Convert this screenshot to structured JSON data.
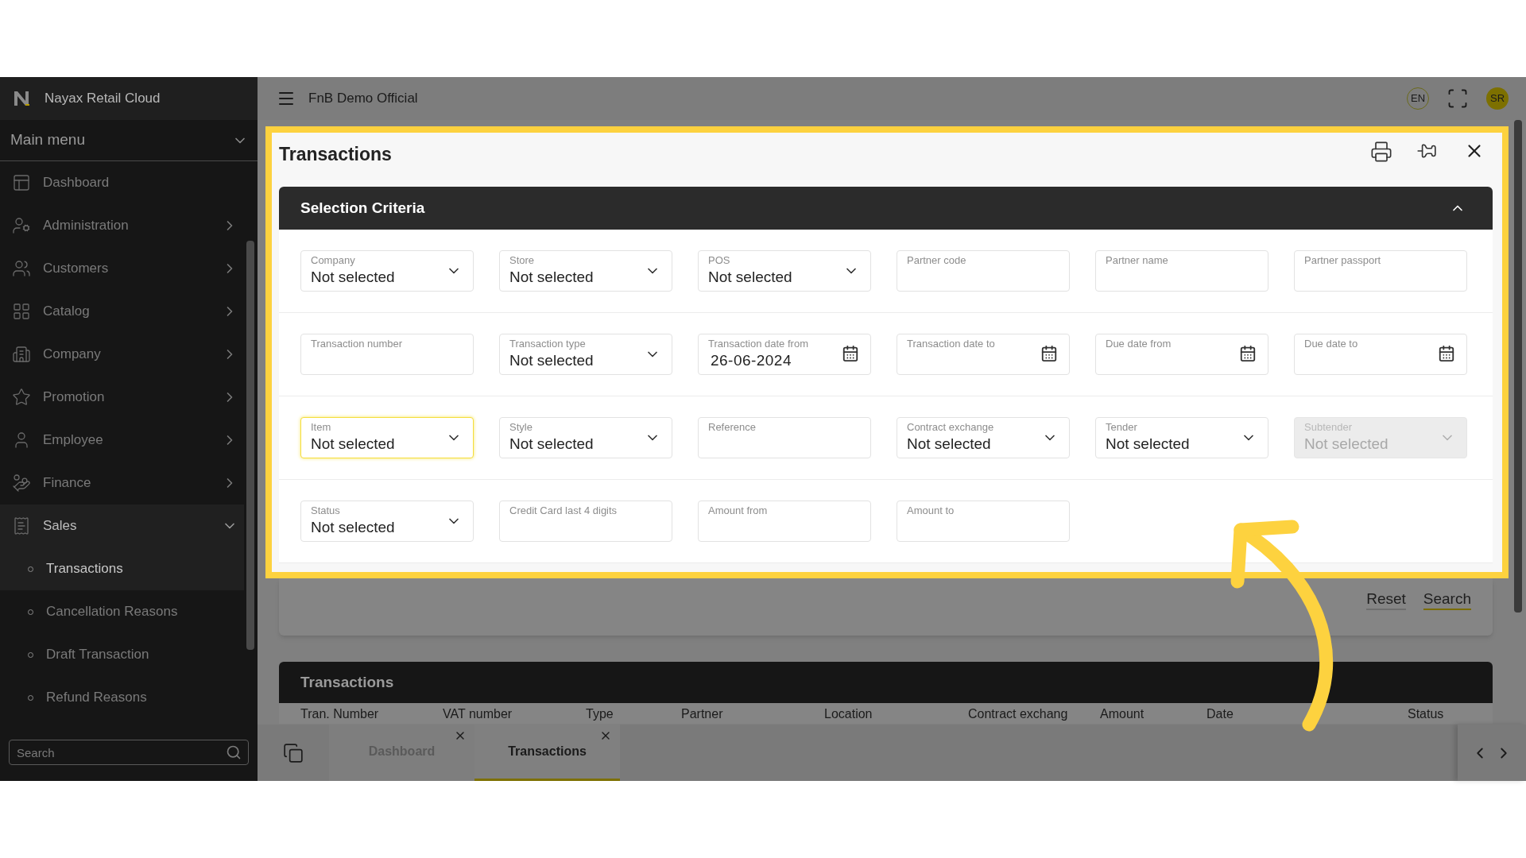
{
  "app": {
    "name": "Nayax Retail Cloud"
  },
  "sidebar": {
    "title": "Main menu",
    "items": [
      {
        "label": "Dashboard",
        "kind": "link",
        "expanded": false
      },
      {
        "label": "Administration",
        "kind": "group",
        "expanded": false
      },
      {
        "label": "Customers",
        "kind": "group",
        "expanded": false
      },
      {
        "label": "Catalog",
        "kind": "group",
        "expanded": false
      },
      {
        "label": "Company",
        "kind": "group",
        "expanded": false
      },
      {
        "label": "Promotion",
        "kind": "group",
        "expanded": false
      },
      {
        "label": "Employee",
        "kind": "group",
        "expanded": false
      },
      {
        "label": "Finance",
        "kind": "group",
        "expanded": false
      },
      {
        "label": "Sales",
        "kind": "group",
        "expanded": true,
        "children": [
          {
            "label": "Transactions",
            "selected": true
          },
          {
            "label": "Cancellation Reasons",
            "selected": false
          },
          {
            "label": "Draft Transaction",
            "selected": false
          },
          {
            "label": "Refund Reasons",
            "selected": false
          }
        ]
      }
    ],
    "search": {
      "placeholder": "Search"
    }
  },
  "header": {
    "title": "FnB Demo Official",
    "language": "EN",
    "user_initials": "SR"
  },
  "panel": {
    "title": "Transactions",
    "criteria": {
      "title": "Selection Criteria",
      "expanded": true,
      "rows": [
        [
          {
            "label": "Company",
            "kind": "select",
            "value": "Not selected",
            "focused": false,
            "disabled": false
          },
          {
            "label": "Store",
            "kind": "select",
            "value": "Not selected",
            "focused": false,
            "disabled": false
          },
          {
            "label": "POS",
            "kind": "select",
            "value": "Not selected",
            "focused": false,
            "disabled": false
          },
          {
            "label": "Partner code",
            "kind": "text",
            "focused": false,
            "disabled": false
          },
          {
            "label": "Partner name",
            "kind": "text",
            "focused": false,
            "disabled": false
          },
          {
            "label": "Partner passport",
            "kind": "text",
            "focused": false,
            "disabled": false
          }
        ],
        [
          {
            "label": "Transaction number",
            "kind": "text",
            "focused": false,
            "disabled": false
          },
          {
            "label": "Transaction type",
            "kind": "select",
            "value": "Not selected",
            "focused": false,
            "disabled": false
          },
          {
            "label": "Transaction date from",
            "kind": "date",
            "value": "26-06-2024",
            "focused": false,
            "disabled": false
          },
          {
            "label": "Transaction date to",
            "kind": "date",
            "focused": false,
            "disabled": false
          },
          {
            "label": "Due date from",
            "kind": "date",
            "focused": false,
            "disabled": false
          },
          {
            "label": "Due date to",
            "kind": "date",
            "focused": false,
            "disabled": false
          }
        ],
        [
          {
            "label": "Item",
            "kind": "select",
            "value": "Not selected",
            "focused": true,
            "disabled": false
          },
          {
            "label": "Style",
            "kind": "select",
            "value": "Not selected",
            "focused": false,
            "disabled": false
          },
          {
            "label": "Reference",
            "kind": "text",
            "focused": false,
            "disabled": false
          },
          {
            "label": "Contract exchange",
            "kind": "select",
            "value": "Not selected",
            "focused": false,
            "disabled": false
          },
          {
            "label": "Tender",
            "kind": "select",
            "value": "Not selected",
            "focused": false,
            "disabled": false
          },
          {
            "label": "Subtender",
            "kind": "select",
            "value": "Not selected",
            "focused": false,
            "disabled": true
          }
        ],
        [
          {
            "label": "Status",
            "kind": "select",
            "value": "Not selected",
            "focused": false,
            "disabled": false
          },
          {
            "label": "Credit Card last 4 digits",
            "kind": "text",
            "focused": false,
            "disabled": false
          },
          {
            "label": "Amount from",
            "kind": "text",
            "focused": false,
            "disabled": false
          },
          {
            "label": "Amount to",
            "kind": "text",
            "focused": false,
            "disabled": false
          }
        ]
      ]
    },
    "buttons": [
      {
        "label": "Reset",
        "primary": false
      },
      {
        "label": "Search",
        "primary": true
      }
    ]
  },
  "results": {
    "title": "Transactions",
    "columns": [
      "Tran. Number",
      "VAT number",
      "Type",
      "Partner",
      "Location",
      "Contract exchang",
      "Amount",
      "Date",
      "Status"
    ]
  },
  "tabs": [
    {
      "label": "Dashboard",
      "selected": false
    },
    {
      "label": "Transactions",
      "selected": true
    }
  ]
}
